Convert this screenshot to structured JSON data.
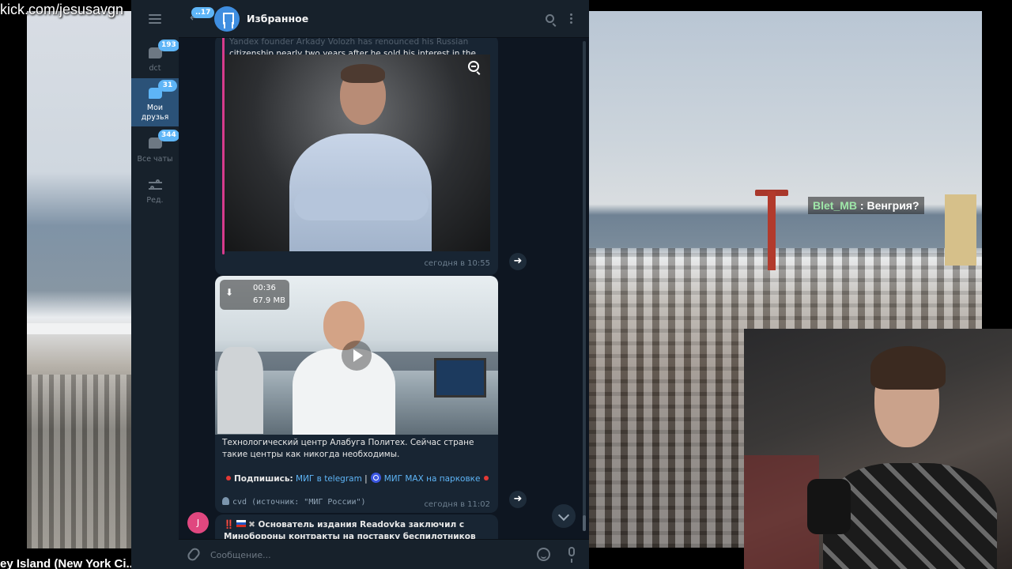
{
  "stream": {
    "watermark": "kick.com/jesusavgn",
    "bottom_caption": "ey Island (New York Ci...",
    "chat_overlay": {
      "user": "Blet_MB",
      "message": " : Венгрия?"
    }
  },
  "telegram": {
    "folders": [
      {
        "label": "dct",
        "badge": "193",
        "icon": "chat-bubbles-icon"
      },
      {
        "label": "Мои друзья",
        "badge": "31",
        "icon": "chat-bubbles-icon",
        "active": true
      },
      {
        "label": "Все чаты",
        "badge": "344",
        "icon": "chat-bubbles-icon"
      },
      {
        "label": "Ред.",
        "icon": "sliders-icon"
      }
    ],
    "header": {
      "back_badge": "..17",
      "title": "Избранное"
    },
    "messages": [
      {
        "quote_text_faded": "Yandex founder Arkady Volozh has renounced his Russian",
        "quote_text": "citizenship nearly two years after he sold his interest in the cou...",
        "time": "сегодня в 10:55"
      },
      {
        "video": {
          "duration": "00:36",
          "size": "67.9 MB"
        },
        "text": "Технологический центр Алабуга Политех. Сейчас стране такие центры как никогда необходимы.",
        "subscribe_label": "Подпишись:",
        "link1": "МИГ в telegram",
        "separator": "|",
        "link2": "МИГ MAX на парковке",
        "footer": "cvd (источник: \"МИГ России\")",
        "time": "сегодня в 11:02"
      },
      {
        "avatar_letter": "J",
        "prefix": "‼️",
        "text": "Основатель издания Readovka заключил с Минобороны контракты на поставку беспилотников на"
      }
    ],
    "composer": {
      "placeholder": "Сообщение..."
    }
  },
  "colors": {
    "accent": "#5eb5f7",
    "window_bg": "#0e1621",
    "panel_bg": "#17212b",
    "bubble_bg": "#182533",
    "quote_bar": "#d63b8c"
  }
}
